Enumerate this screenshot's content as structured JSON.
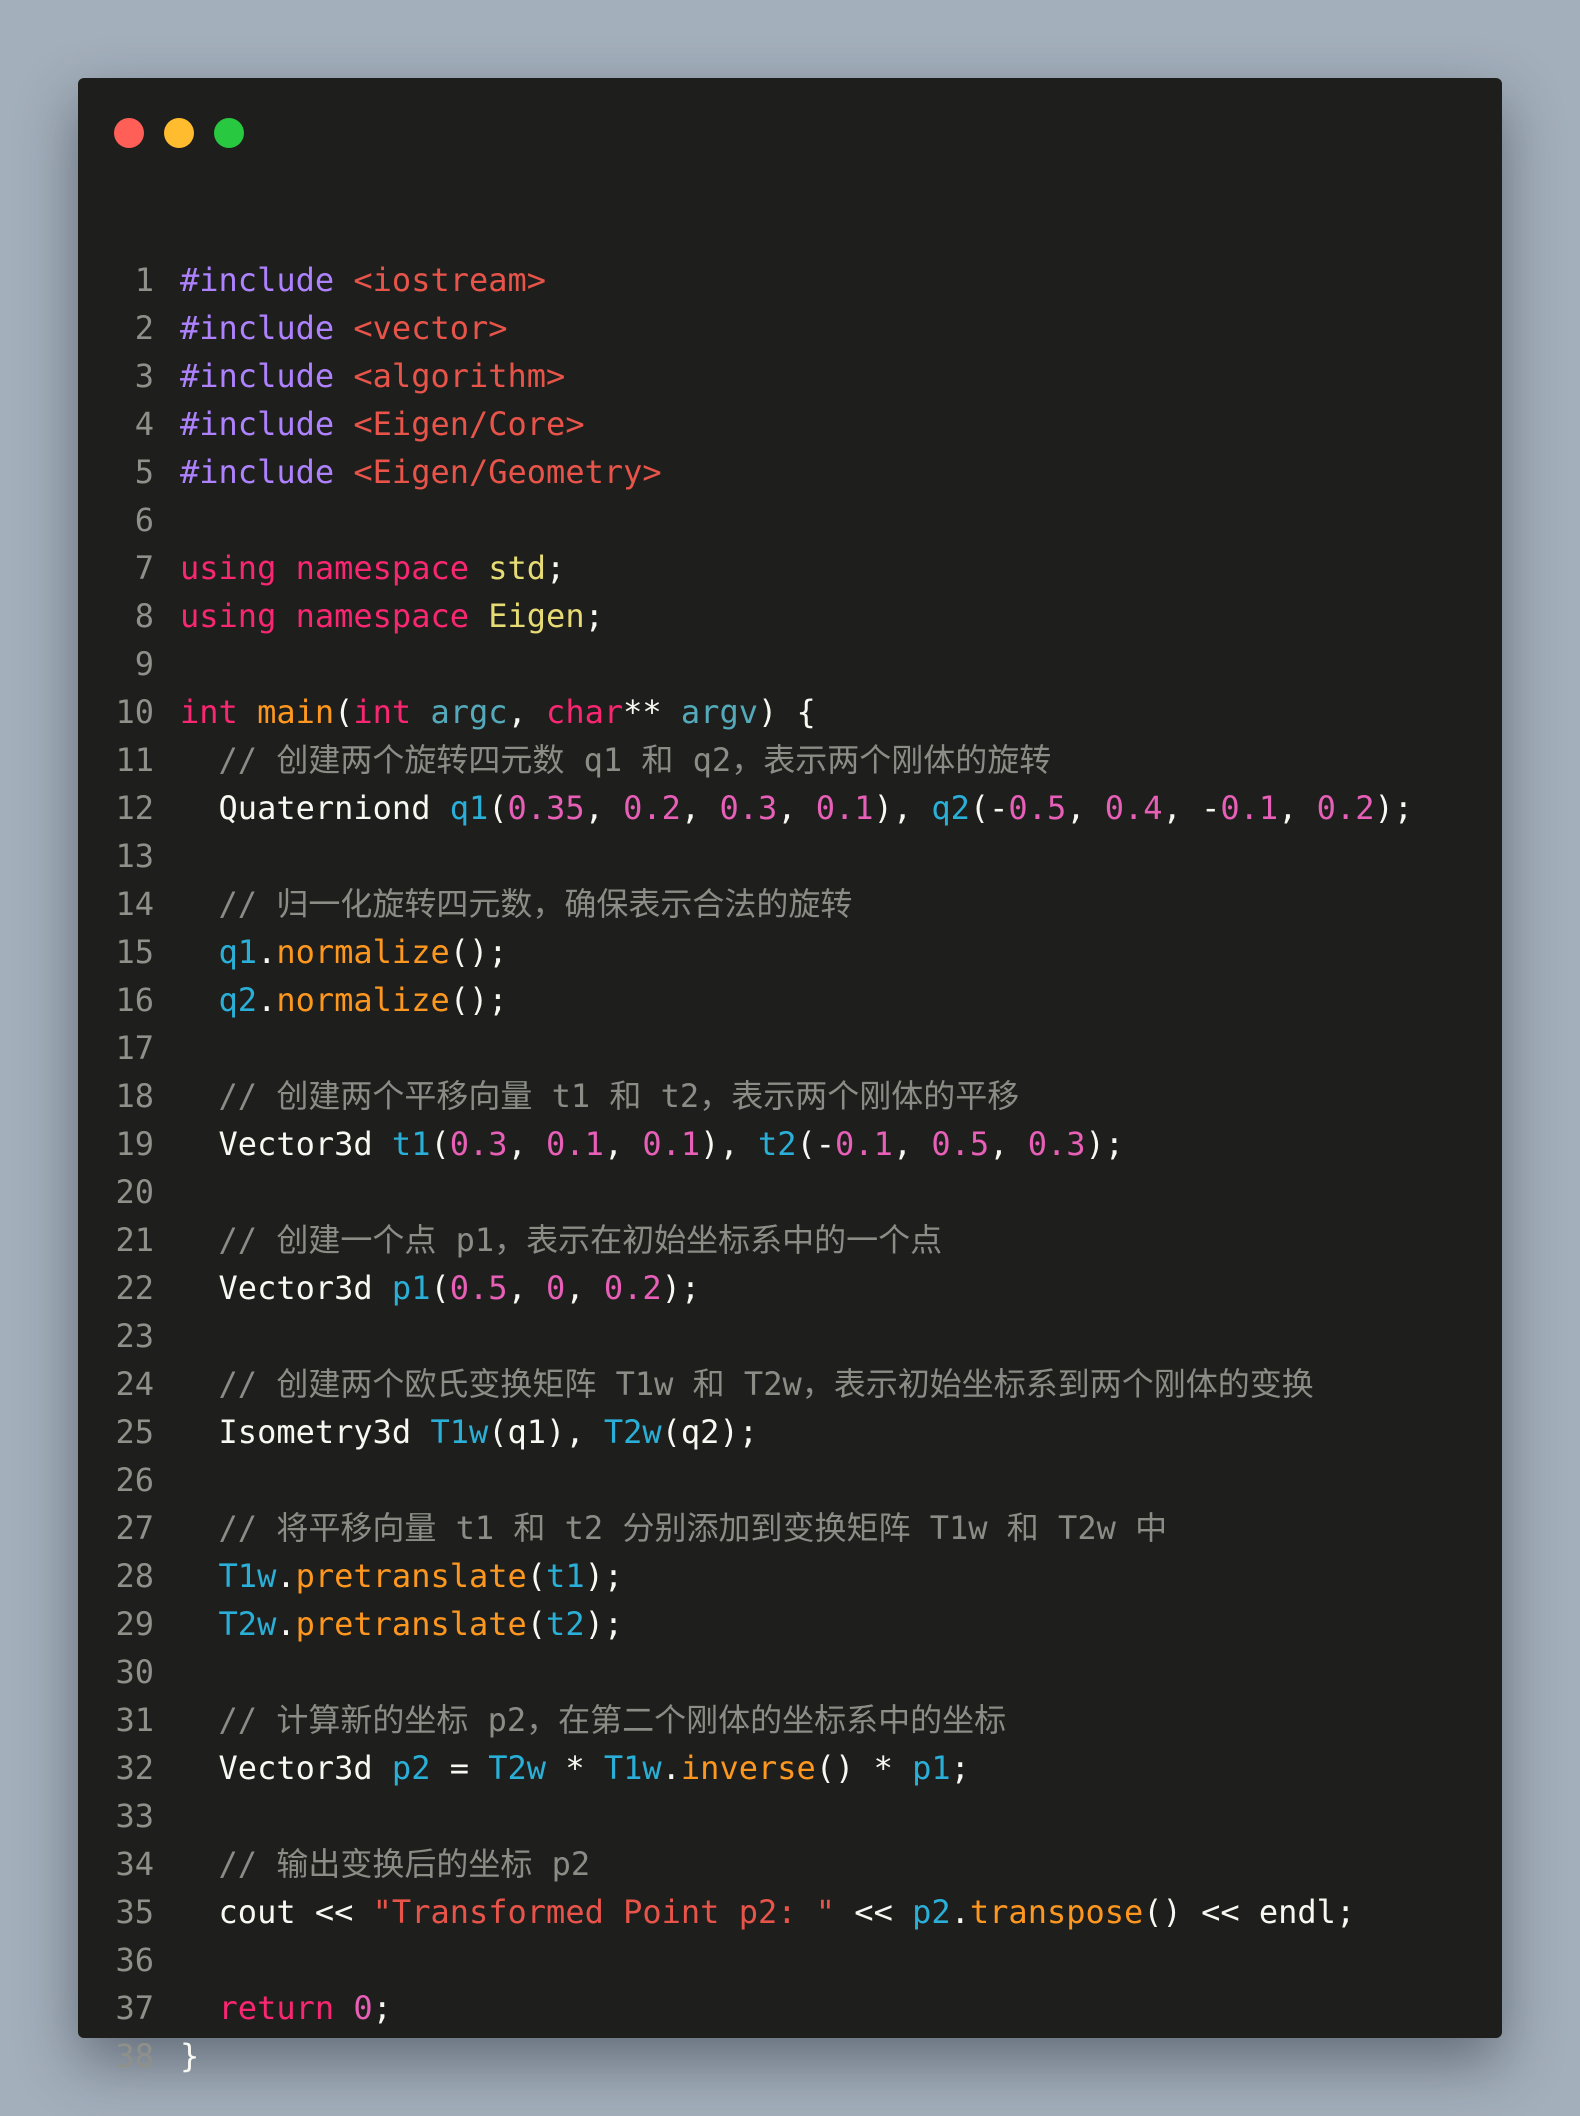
{
  "window": {
    "controls": {
      "close_color": "#ff5f57",
      "minimize_color": "#febc2e",
      "maximize_color": "#28c840"
    }
  },
  "editor": {
    "lines": [
      {
        "n": "1",
        "tokens": [
          {
            "t": "preproc",
            "v": "#include"
          },
          {
            "t": "plain",
            "v": " "
          },
          {
            "t": "header",
            "v": "<iostream>"
          }
        ]
      },
      {
        "n": "2",
        "tokens": [
          {
            "t": "preproc",
            "v": "#include"
          },
          {
            "t": "plain",
            "v": " "
          },
          {
            "t": "header",
            "v": "<vector>"
          }
        ]
      },
      {
        "n": "3",
        "tokens": [
          {
            "t": "preproc",
            "v": "#include"
          },
          {
            "t": "plain",
            "v": " "
          },
          {
            "t": "header",
            "v": "<algorithm>"
          }
        ]
      },
      {
        "n": "4",
        "tokens": [
          {
            "t": "preproc",
            "v": "#include"
          },
          {
            "t": "plain",
            "v": " "
          },
          {
            "t": "header",
            "v": "<Eigen/Core>"
          }
        ]
      },
      {
        "n": "5",
        "tokens": [
          {
            "t": "preproc",
            "v": "#include"
          },
          {
            "t": "plain",
            "v": " "
          },
          {
            "t": "header",
            "v": "<Eigen/Geometry>"
          }
        ]
      },
      {
        "n": "6",
        "tokens": []
      },
      {
        "n": "7",
        "tokens": [
          {
            "t": "keyword",
            "v": "using"
          },
          {
            "t": "plain",
            "v": " "
          },
          {
            "t": "keyword",
            "v": "namespace"
          },
          {
            "t": "plain",
            "v": " "
          },
          {
            "t": "namespace",
            "v": "std"
          },
          {
            "t": "plain",
            "v": ";"
          }
        ]
      },
      {
        "n": "8",
        "tokens": [
          {
            "t": "keyword",
            "v": "using"
          },
          {
            "t": "plain",
            "v": " "
          },
          {
            "t": "keyword",
            "v": "namespace"
          },
          {
            "t": "plain",
            "v": " "
          },
          {
            "t": "namespace",
            "v": "Eigen"
          },
          {
            "t": "plain",
            "v": ";"
          }
        ]
      },
      {
        "n": "9",
        "tokens": []
      },
      {
        "n": "10",
        "tokens": [
          {
            "t": "type",
            "v": "int"
          },
          {
            "t": "plain",
            "v": " "
          },
          {
            "t": "func",
            "v": "main"
          },
          {
            "t": "plain",
            "v": "("
          },
          {
            "t": "type",
            "v": "int"
          },
          {
            "t": "plain",
            "v": " "
          },
          {
            "t": "param",
            "v": "argc"
          },
          {
            "t": "plain",
            "v": ", "
          },
          {
            "t": "type",
            "v": "char"
          },
          {
            "t": "plain",
            "v": "** "
          },
          {
            "t": "param",
            "v": "argv"
          },
          {
            "t": "plain",
            "v": ") {"
          }
        ]
      },
      {
        "n": "11",
        "tokens": [
          {
            "t": "plain",
            "v": "  "
          },
          {
            "t": "comment",
            "v": "// 创建两个旋转四元数 q1 和 q2，表示两个刚体的旋转"
          }
        ]
      },
      {
        "n": "12",
        "tokens": [
          {
            "t": "plain",
            "v": "  "
          },
          {
            "t": "class",
            "v": "Quaterniond"
          },
          {
            "t": "plain",
            "v": " "
          },
          {
            "t": "var",
            "v": "q1"
          },
          {
            "t": "plain",
            "v": "("
          },
          {
            "t": "num",
            "v": "0.35"
          },
          {
            "t": "plain",
            "v": ", "
          },
          {
            "t": "num",
            "v": "0.2"
          },
          {
            "t": "plain",
            "v": ", "
          },
          {
            "t": "num",
            "v": "0.3"
          },
          {
            "t": "plain",
            "v": ", "
          },
          {
            "t": "num",
            "v": "0.1"
          },
          {
            "t": "plain",
            "v": "), "
          },
          {
            "t": "var",
            "v": "q2"
          },
          {
            "t": "plain",
            "v": "(-"
          },
          {
            "t": "num",
            "v": "0.5"
          },
          {
            "t": "plain",
            "v": ", "
          },
          {
            "t": "num",
            "v": "0.4"
          },
          {
            "t": "plain",
            "v": ", -"
          },
          {
            "t": "num",
            "v": "0.1"
          },
          {
            "t": "plain",
            "v": ", "
          },
          {
            "t": "num",
            "v": "0.2"
          },
          {
            "t": "plain",
            "v": ");"
          }
        ]
      },
      {
        "n": "13",
        "tokens": []
      },
      {
        "n": "14",
        "tokens": [
          {
            "t": "plain",
            "v": "  "
          },
          {
            "t": "comment",
            "v": "// 归一化旋转四元数，确保表示合法的旋转"
          }
        ]
      },
      {
        "n": "15",
        "tokens": [
          {
            "t": "plain",
            "v": "  "
          },
          {
            "t": "var",
            "v": "q1"
          },
          {
            "t": "plain",
            "v": "."
          },
          {
            "t": "func",
            "v": "normalize"
          },
          {
            "t": "plain",
            "v": "();"
          }
        ]
      },
      {
        "n": "16",
        "tokens": [
          {
            "t": "plain",
            "v": "  "
          },
          {
            "t": "var",
            "v": "q2"
          },
          {
            "t": "plain",
            "v": "."
          },
          {
            "t": "func",
            "v": "normalize"
          },
          {
            "t": "plain",
            "v": "();"
          }
        ]
      },
      {
        "n": "17",
        "tokens": []
      },
      {
        "n": "18",
        "tokens": [
          {
            "t": "plain",
            "v": "  "
          },
          {
            "t": "comment",
            "v": "// 创建两个平移向量 t1 和 t2，表示两个刚体的平移"
          }
        ]
      },
      {
        "n": "19",
        "tokens": [
          {
            "t": "plain",
            "v": "  "
          },
          {
            "t": "class",
            "v": "Vector3d"
          },
          {
            "t": "plain",
            "v": " "
          },
          {
            "t": "var",
            "v": "t1"
          },
          {
            "t": "plain",
            "v": "("
          },
          {
            "t": "num",
            "v": "0.3"
          },
          {
            "t": "plain",
            "v": ", "
          },
          {
            "t": "num",
            "v": "0.1"
          },
          {
            "t": "plain",
            "v": ", "
          },
          {
            "t": "num",
            "v": "0.1"
          },
          {
            "t": "plain",
            "v": "), "
          },
          {
            "t": "var",
            "v": "t2"
          },
          {
            "t": "plain",
            "v": "(-"
          },
          {
            "t": "num",
            "v": "0.1"
          },
          {
            "t": "plain",
            "v": ", "
          },
          {
            "t": "num",
            "v": "0.5"
          },
          {
            "t": "plain",
            "v": ", "
          },
          {
            "t": "num",
            "v": "0.3"
          },
          {
            "t": "plain",
            "v": ");"
          }
        ]
      },
      {
        "n": "20",
        "tokens": []
      },
      {
        "n": "21",
        "tokens": [
          {
            "t": "plain",
            "v": "  "
          },
          {
            "t": "comment",
            "v": "// 创建一个点 p1，表示在初始坐标系中的一个点"
          }
        ]
      },
      {
        "n": "22",
        "tokens": [
          {
            "t": "plain",
            "v": "  "
          },
          {
            "t": "class",
            "v": "Vector3d"
          },
          {
            "t": "plain",
            "v": " "
          },
          {
            "t": "var",
            "v": "p1"
          },
          {
            "t": "plain",
            "v": "("
          },
          {
            "t": "num",
            "v": "0.5"
          },
          {
            "t": "plain",
            "v": ", "
          },
          {
            "t": "num",
            "v": "0"
          },
          {
            "t": "plain",
            "v": ", "
          },
          {
            "t": "num",
            "v": "0.2"
          },
          {
            "t": "plain",
            "v": ");"
          }
        ]
      },
      {
        "n": "23",
        "tokens": []
      },
      {
        "n": "24",
        "tokens": [
          {
            "t": "plain",
            "v": "  "
          },
          {
            "t": "comment",
            "v": "// 创建两个欧氏变换矩阵 T1w 和 T2w，表示初始坐标系到两个刚体的变换"
          }
        ]
      },
      {
        "n": "25",
        "tokens": [
          {
            "t": "plain",
            "v": "  "
          },
          {
            "t": "class",
            "v": "Isometry3d"
          },
          {
            "t": "plain",
            "v": " "
          },
          {
            "t": "var",
            "v": "T1w"
          },
          {
            "t": "plain",
            "v": "(q1), "
          },
          {
            "t": "var",
            "v": "T2w"
          },
          {
            "t": "plain",
            "v": "(q2);"
          }
        ]
      },
      {
        "n": "26",
        "tokens": []
      },
      {
        "n": "27",
        "tokens": [
          {
            "t": "plain",
            "v": "  "
          },
          {
            "t": "comment",
            "v": "// 将平移向量 t1 和 t2 分别添加到变换矩阵 T1w 和 T2w 中"
          }
        ]
      },
      {
        "n": "28",
        "tokens": [
          {
            "t": "plain",
            "v": "  "
          },
          {
            "t": "var",
            "v": "T1w"
          },
          {
            "t": "plain",
            "v": "."
          },
          {
            "t": "func",
            "v": "pretranslate"
          },
          {
            "t": "plain",
            "v": "("
          },
          {
            "t": "var",
            "v": "t1"
          },
          {
            "t": "plain",
            "v": ");"
          }
        ]
      },
      {
        "n": "29",
        "tokens": [
          {
            "t": "plain",
            "v": "  "
          },
          {
            "t": "var",
            "v": "T2w"
          },
          {
            "t": "plain",
            "v": "."
          },
          {
            "t": "func",
            "v": "pretranslate"
          },
          {
            "t": "plain",
            "v": "("
          },
          {
            "t": "var",
            "v": "t2"
          },
          {
            "t": "plain",
            "v": ");"
          }
        ]
      },
      {
        "n": "30",
        "tokens": []
      },
      {
        "n": "31",
        "tokens": [
          {
            "t": "plain",
            "v": "  "
          },
          {
            "t": "comment",
            "v": "// 计算新的坐标 p2，在第二个刚体的坐标系中的坐标"
          }
        ]
      },
      {
        "n": "32",
        "tokens": [
          {
            "t": "plain",
            "v": "  "
          },
          {
            "t": "class",
            "v": "Vector3d"
          },
          {
            "t": "plain",
            "v": " "
          },
          {
            "t": "var",
            "v": "p2"
          },
          {
            "t": "plain",
            "v": " = "
          },
          {
            "t": "var",
            "v": "T2w"
          },
          {
            "t": "plain",
            "v": " * "
          },
          {
            "t": "var",
            "v": "T1w"
          },
          {
            "t": "plain",
            "v": "."
          },
          {
            "t": "func",
            "v": "inverse"
          },
          {
            "t": "plain",
            "v": "() * "
          },
          {
            "t": "var",
            "v": "p1"
          },
          {
            "t": "plain",
            "v": ";"
          }
        ]
      },
      {
        "n": "33",
        "tokens": []
      },
      {
        "n": "34",
        "tokens": [
          {
            "t": "plain",
            "v": "  "
          },
          {
            "t": "comment",
            "v": "// 输出变换后的坐标 p2"
          }
        ]
      },
      {
        "n": "35",
        "tokens": [
          {
            "t": "plain",
            "v": "  cout << "
          },
          {
            "t": "string",
            "v": "\"Transformed Point p2: \""
          },
          {
            "t": "plain",
            "v": " << "
          },
          {
            "t": "var",
            "v": "p2"
          },
          {
            "t": "plain",
            "v": "."
          },
          {
            "t": "func",
            "v": "transpose"
          },
          {
            "t": "plain",
            "v": "() << endl;"
          }
        ]
      },
      {
        "n": "36",
        "tokens": []
      },
      {
        "n": "37",
        "tokens": [
          {
            "t": "plain",
            "v": "  "
          },
          {
            "t": "keyword",
            "v": "return"
          },
          {
            "t": "plain",
            "v": " "
          },
          {
            "t": "num",
            "v": "0"
          },
          {
            "t": "plain",
            "v": ";"
          }
        ]
      },
      {
        "n": "38",
        "tokens": [
          {
            "t": "plain",
            "v": "}"
          }
        ]
      }
    ]
  }
}
